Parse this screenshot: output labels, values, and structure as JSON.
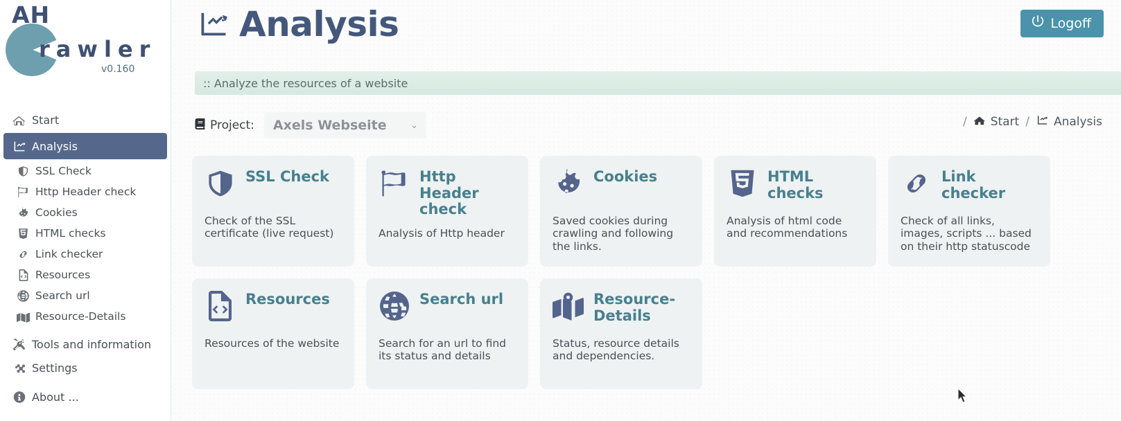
{
  "brand": {
    "name_top": "AH",
    "name_main": "rawler",
    "version": "v0.160",
    "logo_color": "#6e9fae",
    "text_color": "#3f5172"
  },
  "sidebar": {
    "items": [
      {
        "label": "Start",
        "icon": "home-icon",
        "level": "top",
        "active": false
      },
      {
        "label": "Analysis",
        "icon": "chart-line-icon",
        "level": "top",
        "active": true
      },
      {
        "label": "SSL Check",
        "icon": "shield-icon",
        "level": "sub",
        "active": false
      },
      {
        "label": "Http Header check",
        "icon": "flag-icon",
        "level": "sub",
        "active": false
      },
      {
        "label": "Cookies",
        "icon": "cookie-icon",
        "level": "sub",
        "active": false
      },
      {
        "label": "HTML checks",
        "icon": "html5-icon",
        "level": "sub",
        "active": false
      },
      {
        "label": "Link checker",
        "icon": "link-icon",
        "level": "sub",
        "active": false
      },
      {
        "label": "Resources",
        "icon": "file-code-icon",
        "level": "sub",
        "active": false
      },
      {
        "label": "Search url",
        "icon": "globe-icon",
        "level": "sub",
        "active": false
      },
      {
        "label": "Resource-Details",
        "icon": "map-icon",
        "level": "sub",
        "active": false
      },
      {
        "label": "Tools and information",
        "icon": "tools-icon",
        "level": "top",
        "active": false
      },
      {
        "label": "Settings",
        "icon": "gears-icon",
        "level": "top",
        "active": false
      },
      {
        "label": "About ...",
        "icon": "info-icon",
        "level": "top",
        "active": false
      }
    ],
    "active_bg": "#55688c"
  },
  "header": {
    "title": "Analysis",
    "title_icon": "chart-line-icon",
    "logoff_label": "Logoff",
    "logoff_icon": "power-icon",
    "logoff_bg": "#4a93ab"
  },
  "subtitle": {
    "text": ":: Analyze the resources of a website",
    "bg": "#dfeae4"
  },
  "project": {
    "icon": "book-icon",
    "label": "Project:",
    "selected": "Axels Webseite",
    "chevron": "⌄",
    "options": [
      "Axels Webseite"
    ]
  },
  "breadcrumb": {
    "sep1": "/",
    "item1": "Start",
    "item1_icon": "home-icon",
    "sep2": "/",
    "item2": "Analysis",
    "item2_icon": "chart-line-icon"
  },
  "cards": {
    "row1": [
      {
        "title": "SSL Check",
        "desc": "Check of the SSL certificate (live request)",
        "icon": "shield-icon"
      },
      {
        "title": "Http Header check",
        "desc": "Analysis of Http header",
        "icon": "flag-icon"
      },
      {
        "title": "Cookies",
        "desc": "Saved cookies during crawling and following the links.",
        "icon": "cookie-icon"
      },
      {
        "title": "HTML checks",
        "desc": "Analysis of html code and recommendations",
        "icon": "html5-icon"
      },
      {
        "title": "Link checker",
        "desc": "Check of all links, images, scripts ... based on their http statuscode",
        "icon": "link-icon"
      }
    ],
    "row2": [
      {
        "title": "Resources",
        "desc": "Resources of the website",
        "icon": "file-code-icon"
      },
      {
        "title": "Search url",
        "desc": "Search for an url to find its status and details",
        "icon": "globe-icon"
      },
      {
        "title": "Resource-Details",
        "desc": "Status, resource details and dependencies.",
        "icon": "map-icon"
      }
    ],
    "bg": "#eef2f2",
    "title_color": "#47808f",
    "icon_color": "#54648c"
  }
}
